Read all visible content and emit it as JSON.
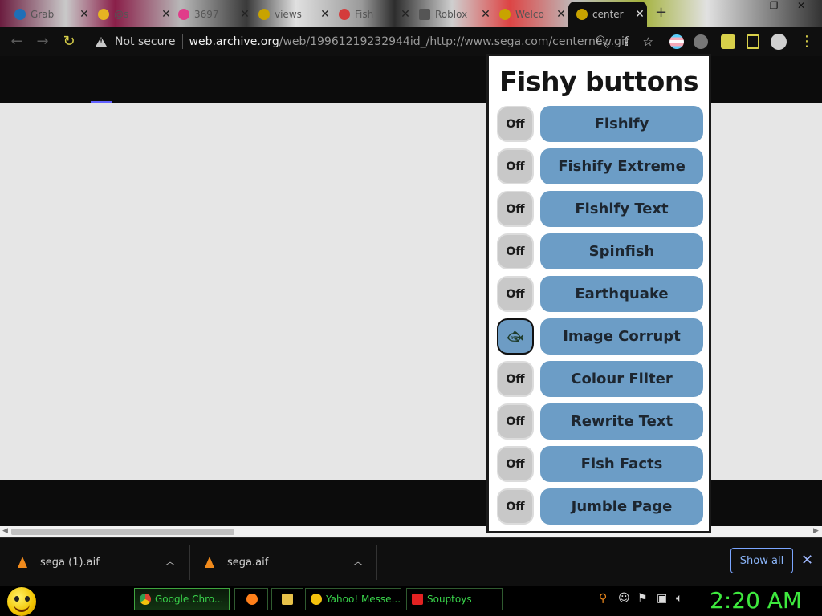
{
  "browser": {
    "tabs": [
      {
        "label": "Grab",
        "color": "#1e6fb7"
      },
      {
        "label": "@s",
        "color": "#e6b422"
      },
      {
        "label": "3697",
        "color": "#e03c8a"
      },
      {
        "label": "views",
        "color": "#c8a300"
      },
      {
        "label": "Fish",
        "color": "#d43b3b"
      },
      {
        "label": "Roblox",
        "color": "#555555"
      },
      {
        "label": "Welco",
        "color": "#c8a300"
      },
      {
        "label": "center",
        "color": "#c8a300"
      }
    ],
    "new_tab_glyph": "+",
    "window_controls": [
      "—",
      "❐",
      "✕"
    ],
    "nav": {
      "back": "←",
      "forward": "→",
      "reload": "↻"
    },
    "security_label": "Not secure",
    "url_host": "web.archive.org",
    "url_path": "/web/19961219232944id_/http://www.sega.com/centernew.gif"
  },
  "popup": {
    "title": "Fishy buttons",
    "rows": [
      {
        "toggle": "Off",
        "on": false,
        "label": "Fishify"
      },
      {
        "toggle": "Off",
        "on": false,
        "label": "Fishify Extreme"
      },
      {
        "toggle": "Off",
        "on": false,
        "label": "Fishify Text"
      },
      {
        "toggle": "Off",
        "on": false,
        "label": "Spinfish"
      },
      {
        "toggle": "Off",
        "on": false,
        "label": "Earthquake"
      },
      {
        "toggle": "",
        "on": true,
        "icon": "fish-icon",
        "label": "Image Corrupt"
      },
      {
        "toggle": "Off",
        "on": false,
        "label": "Colour Filter"
      },
      {
        "toggle": "Off",
        "on": false,
        "label": "Rewrite Text"
      },
      {
        "toggle": "Off",
        "on": false,
        "label": "Fish Facts"
      },
      {
        "toggle": "Off",
        "on": false,
        "label": "Jumble Page"
      }
    ]
  },
  "downloads": {
    "items": [
      {
        "name": "sega (1).aif"
      },
      {
        "name": "sega.aif"
      }
    ],
    "show_all_label": "Show all",
    "close_glyph": "✕"
  },
  "taskbar": {
    "buttons": [
      {
        "label": "Google Chro...",
        "active": true,
        "color": "#d9432f"
      },
      {
        "label": "",
        "active": false,
        "color": "#ff7f1a"
      },
      {
        "label": "",
        "active": false,
        "color": "#e7c14a"
      },
      {
        "label": "Yahoo! Messe...",
        "active": false,
        "color": "#f4c20d"
      },
      {
        "label": "Souptoys",
        "active": false,
        "color": "#e22222"
      }
    ],
    "clock": "2:20 AM"
  }
}
